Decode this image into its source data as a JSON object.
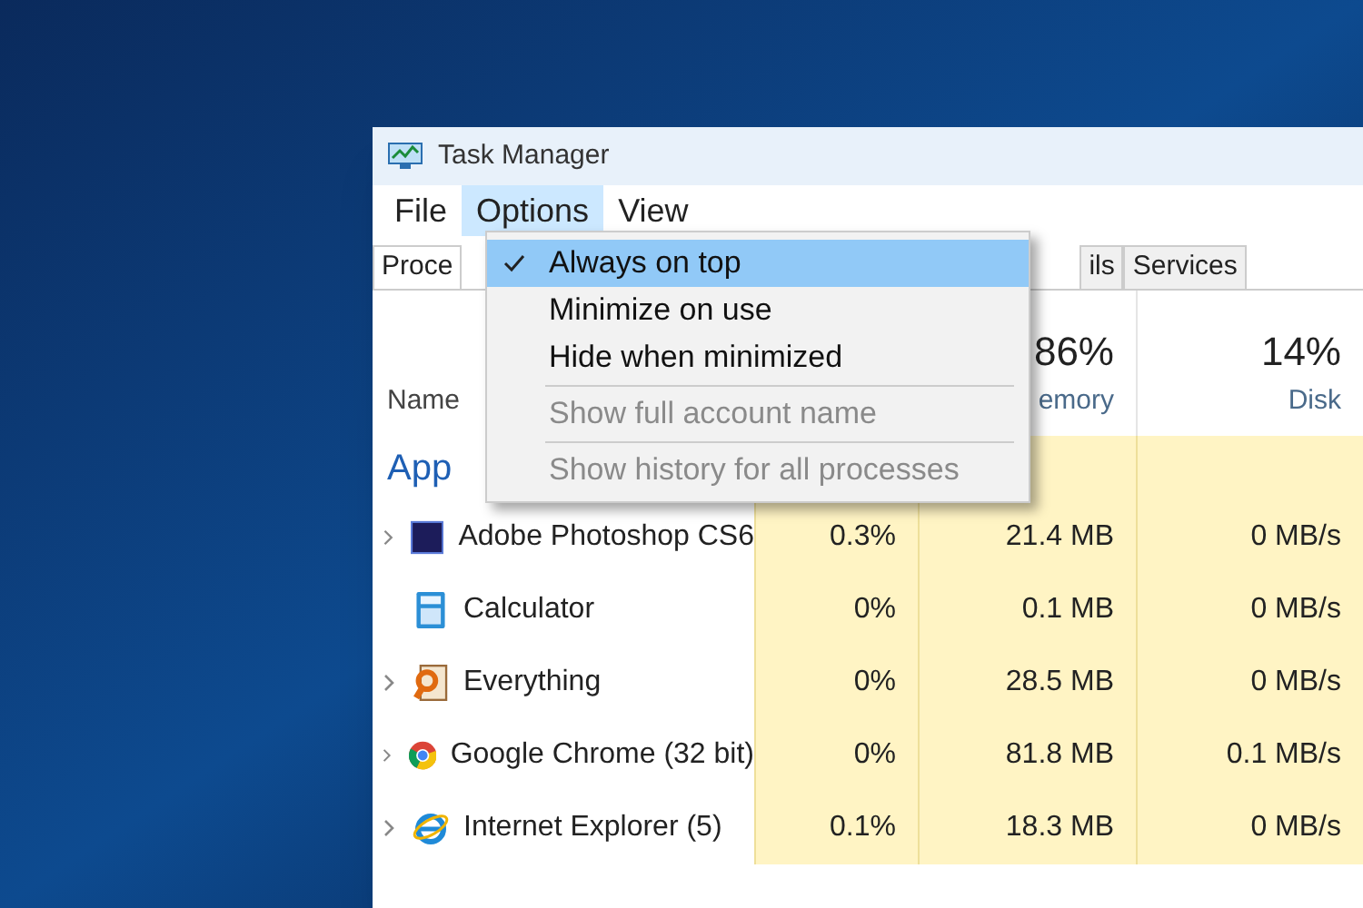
{
  "window": {
    "title": "Task Manager"
  },
  "menu_bar": [
    {
      "label": "File",
      "selected": false
    },
    {
      "label": "Options",
      "selected": true
    },
    {
      "label": "View",
      "selected": false
    }
  ],
  "tabs": [
    {
      "label": "Proce",
      "selected": true
    },
    {
      "label": "ils",
      "selected": false
    },
    {
      "label": "Services",
      "selected": false
    }
  ],
  "options_menu": [
    {
      "label": "Always on top",
      "checked": true,
      "selected": true,
      "disabled": false
    },
    {
      "label": "Minimize on use",
      "checked": false,
      "selected": false,
      "disabled": false
    },
    {
      "label": "Hide when minimized",
      "checked": false,
      "selected": false,
      "disabled": false
    },
    {
      "kind": "separator"
    },
    {
      "label": "Show full account name",
      "checked": false,
      "selected": false,
      "disabled": true
    },
    {
      "kind": "separator"
    },
    {
      "label": "Show history for all processes",
      "checked": false,
      "selected": false,
      "disabled": true
    }
  ],
  "table": {
    "columns": [
      {
        "label": "Name"
      },
      {},
      {
        "usage": "86%",
        "label": "emory"
      },
      {
        "usage": "14%",
        "label": "Disk"
      }
    ],
    "group": "App",
    "rows": [
      {
        "expandable": true,
        "name": "Adobe Photoshop CS6",
        "cpu": "0.3%",
        "memory": "21.4 MB",
        "disk": "0 MB/s"
      },
      {
        "expandable": false,
        "name": "Calculator",
        "cpu": "0%",
        "memory": "0.1 MB",
        "disk": "0 MB/s"
      },
      {
        "expandable": true,
        "name": "Everything",
        "cpu": "0%",
        "memory": "28.5 MB",
        "disk": "0 MB/s"
      },
      {
        "expandable": true,
        "name": "Google Chrome (32 bit)",
        "cpu": "0%",
        "memory": "81.8 MB",
        "disk": "0.1 MB/s"
      },
      {
        "expandable": true,
        "name": "Internet Explorer (5)",
        "cpu": "0.1%",
        "memory": "18.3 MB",
        "disk": "0 MB/s"
      }
    ]
  }
}
